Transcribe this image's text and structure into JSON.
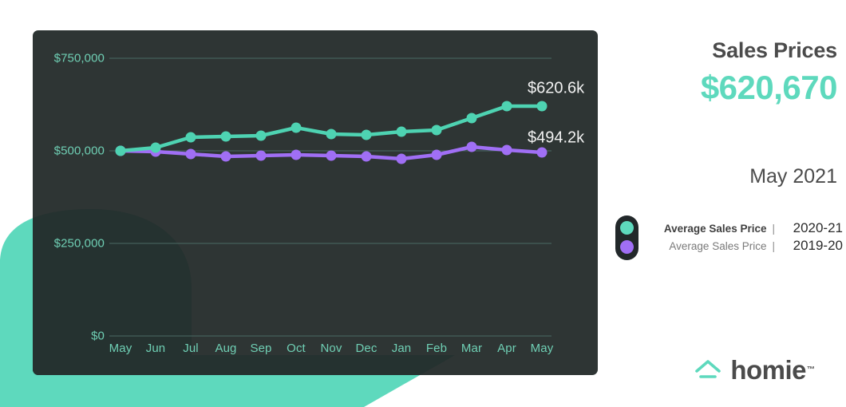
{
  "panel": {
    "title": "Sales Prices",
    "value": "$620,670",
    "date": "May 2021"
  },
  "legend": {
    "series": [
      {
        "name": "Average Sales Price",
        "separator": "|",
        "period": "2020-21",
        "color": "#5ed9bd"
      },
      {
        "name": "Average Sales Price",
        "separator": "|",
        "period": "2019-20",
        "color": "#a06ff5"
      }
    ]
  },
  "logo": {
    "word": "homie",
    "tm": "™",
    "mark": "house-roof-icon",
    "color": "#5ed9bd"
  },
  "theme": {
    "teal": "#5ed9bd",
    "purple": "#a06ff5",
    "card_bg": "#2e3534",
    "page_bg": "#ffffff",
    "axis_text": "#6fcfb4",
    "label_text": "#f2f2f2"
  },
  "chart_data": {
    "type": "line",
    "title": "Sales Prices",
    "xlabel": "",
    "ylabel": "",
    "grid": true,
    "legend_position": "right",
    "categories": [
      "May",
      "Jun",
      "Jul",
      "Aug",
      "Sep",
      "Oct",
      "Nov",
      "Dec",
      "Jan",
      "Feb",
      "Mar",
      "Apr",
      "May"
    ],
    "ylim": [
      0,
      812500
    ],
    "yticks": [
      0,
      250000,
      500000,
      750000
    ],
    "ytick_labels": [
      "$0",
      "$250,000",
      "$500,000",
      "$750,000"
    ],
    "series": [
      {
        "name": "Average Sales Price",
        "period": "2020-21",
        "color": "#5ed9bd",
        "values": [
          500000,
          510000,
          537000,
          539000,
          541000,
          562000,
          545000,
          543000,
          552000,
          556000,
          588000,
          620000,
          620670
        ],
        "end_label": "$620.6k"
      },
      {
        "name": "Average Sales Price",
        "period": "2019-20",
        "color": "#a06ff5",
        "values": [
          500000,
          498000,
          491000,
          485000,
          487000,
          489000,
          487000,
          485000,
          479000,
          489000,
          511000,
          502000,
          494200
        ],
        "end_label": "$494.2k"
      }
    ]
  }
}
